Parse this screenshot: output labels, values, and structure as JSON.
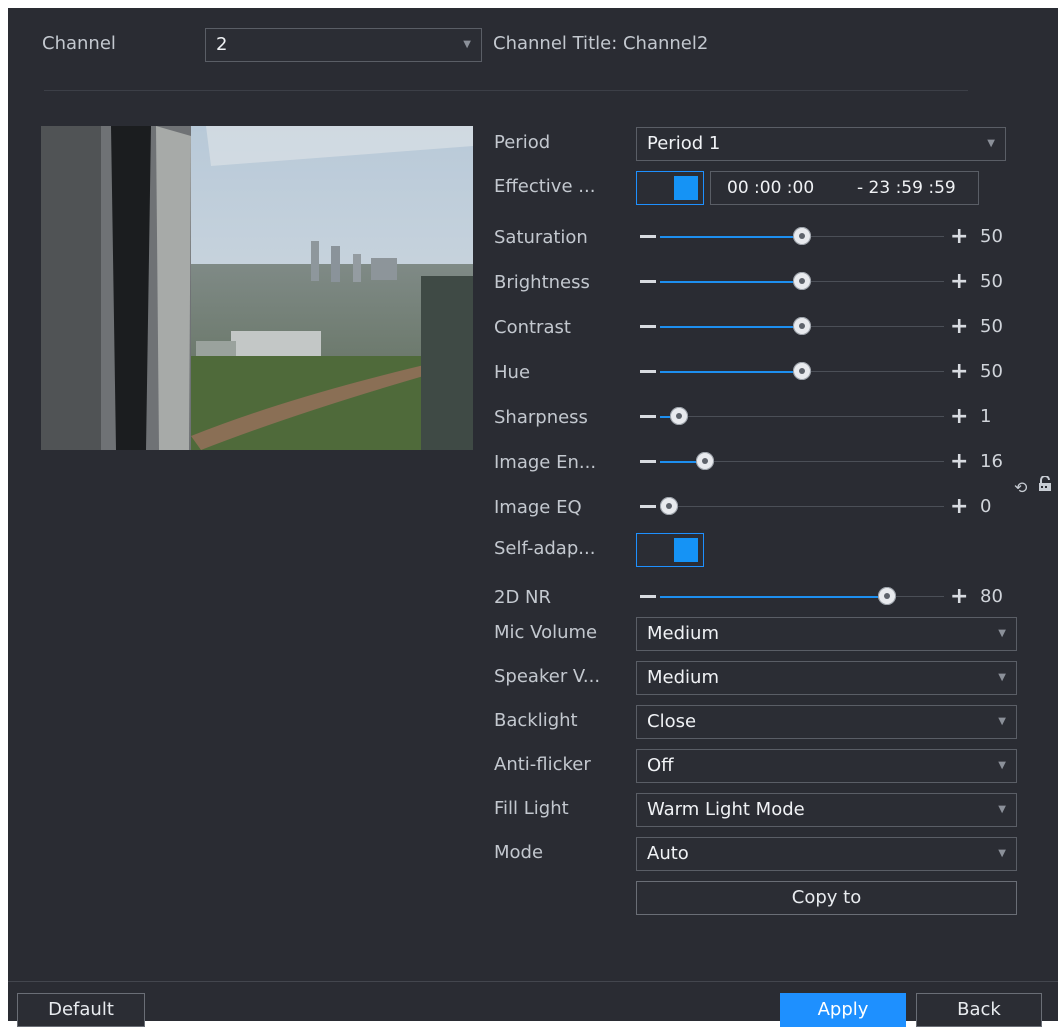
{
  "header": {
    "channel_label": "Channel",
    "channel_value": "2",
    "channel_title": "Channel Title: Channel2"
  },
  "settings": {
    "period_label": "Period",
    "period_value": "Period 1",
    "effective_label": "Effective ...",
    "effective_switch": "on",
    "time_start": "00 :00 :00",
    "time_end": "- 23 :59 :59",
    "sliders": [
      {
        "label": "Saturation",
        "value": 50,
        "min": 0,
        "max": 100,
        "display": "50"
      },
      {
        "label": "Brightness",
        "value": 50,
        "min": 0,
        "max": 100,
        "display": "50"
      },
      {
        "label": "Contrast",
        "value": 50,
        "min": 0,
        "max": 100,
        "display": "50"
      },
      {
        "label": "Hue",
        "value": 50,
        "min": 0,
        "max": 100,
        "display": "50"
      },
      {
        "label": "Sharpness",
        "value": 1,
        "min": 0,
        "max": 15,
        "display": "1"
      },
      {
        "label": "Image En...",
        "value": 16,
        "min": 0,
        "max": 100,
        "display": "16"
      },
      {
        "label": "Image EQ",
        "value": 0,
        "min": 0,
        "max": 100,
        "display": "0"
      }
    ],
    "self_adaptive_label": "Self-adap...",
    "self_adaptive_switch": "on",
    "nr_slider": {
      "label": "2D NR",
      "value": 80,
      "min": 0,
      "max": 100,
      "display": "80"
    },
    "dropdowns": [
      {
        "label": "Mic Volume",
        "value": "Medium"
      },
      {
        "label": "Speaker V...",
        "value": "Medium"
      },
      {
        "label": "Backlight",
        "value": "Close"
      },
      {
        "label": "Anti-flicker",
        "value": "Off"
      },
      {
        "label": "Fill Light",
        "value": "Warm Light Mode"
      },
      {
        "label": "Mode",
        "value": "Auto"
      }
    ],
    "copy_to": "Copy to"
  },
  "footer": {
    "default": "Default",
    "apply": "Apply",
    "back": "Back"
  },
  "icons": {
    "dropdown": "chevron-down-icon",
    "refresh": "refresh-icon",
    "lock": "lock-icon"
  },
  "colors": {
    "background": "#2a2c33",
    "accent": "#1e90ff"
  }
}
